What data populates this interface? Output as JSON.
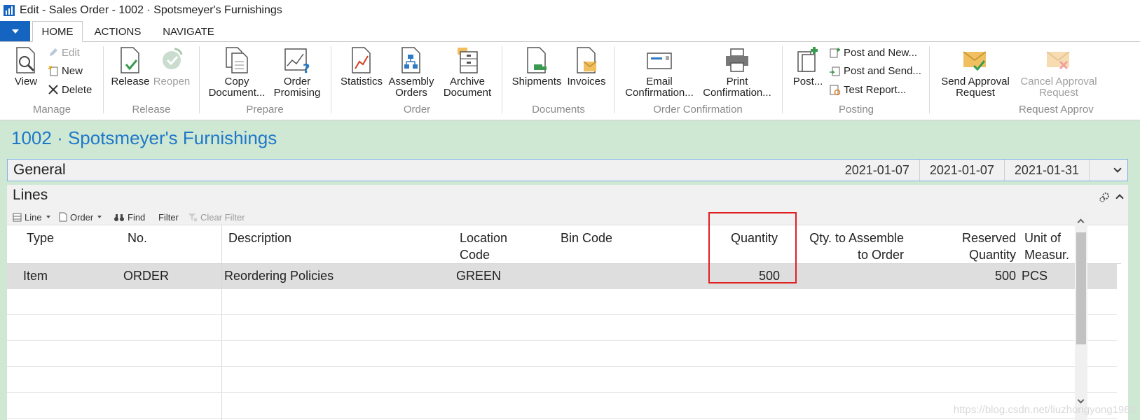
{
  "window": {
    "title": "Edit - Sales Order - 1002 · Spotsmeyer's Furnishings"
  },
  "tabs": [
    {
      "label": "HOME",
      "active": true
    },
    {
      "label": "ACTIONS",
      "active": false
    },
    {
      "label": "NAVIGATE",
      "active": false
    }
  ],
  "ribbon": {
    "manage": {
      "group": "Manage",
      "view": "View",
      "edit": "Edit",
      "new": "New",
      "delete": "Delete"
    },
    "release": {
      "group": "Release",
      "release": "Release",
      "reopen": "Reopen"
    },
    "prepare": {
      "group": "Prepare",
      "copy_l1": "Copy",
      "copy_l2": "Document...",
      "order_l1": "Order",
      "order_l2": "Promising"
    },
    "order": {
      "group": "Order",
      "statistics": "Statistics",
      "assembly_l1": "Assembly",
      "assembly_l2": "Orders",
      "archive_l1": "Archive",
      "archive_l2": "Document"
    },
    "documents": {
      "group": "Documents",
      "shipments": "Shipments",
      "invoices": "Invoices"
    },
    "order_confirmation": {
      "group": "Order Confirmation",
      "email_l1": "Email",
      "email_l2": "Confirmation...",
      "print_l1": "Print",
      "print_l2": "Confirmation..."
    },
    "posting": {
      "group": "Posting",
      "post": "Post...",
      "post_new": "Post and New...",
      "post_send": "Post and Send...",
      "test_report": "Test Report..."
    },
    "request_approval": {
      "group": "Request Approv",
      "send_l1": "Send Approval",
      "send_l2": "Request",
      "cancel_l1": "Cancel Approval",
      "cancel_l2": "Request"
    }
  },
  "page": {
    "title": "1002 · Spotsmeyer's Furnishings"
  },
  "general": {
    "label": "General",
    "dates": [
      "2021-01-07",
      "2021-01-07",
      "2021-01-31"
    ]
  },
  "lines": {
    "label": "Lines",
    "toolbar": {
      "line": "Line",
      "order": "Order",
      "find": "Find",
      "filter": "Filter",
      "clear_filter": "Clear Filter"
    },
    "columns": {
      "type": "Type",
      "no": "No.",
      "description": "Description",
      "location_l1": "Location",
      "location_l2": "Code",
      "bin_code": "Bin Code",
      "quantity": "Quantity",
      "qty_assemble_l1": "Qty. to Assemble",
      "qty_assemble_l2": "to Order",
      "reserved_l1": "Reserved",
      "reserved_l2": "Quantity",
      "uom_l1": "Unit of",
      "uom_l2": "Measur."
    },
    "rows": [
      {
        "type": "Item",
        "no": "ORDER",
        "description": "Reordering Policies",
        "location": "GREEN",
        "bin_code": "",
        "quantity": "500",
        "qty_assemble": "",
        "reserved": "500",
        "uom": "PCS"
      }
    ]
  },
  "watermark": "https://blog.csdn.net/liuzhongyong1980",
  "colors": {
    "accent": "#1565c0",
    "title_blue": "#1f78c8",
    "content_bg": "#cfe8d4",
    "highlight": "#e02020"
  }
}
